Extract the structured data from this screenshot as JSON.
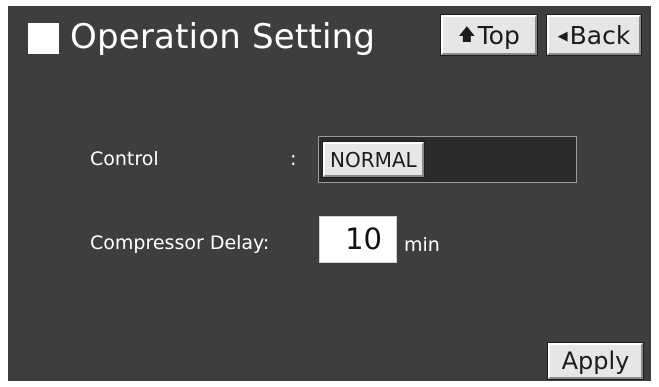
{
  "header": {
    "title": "Operation Setting",
    "top_button": {
      "icon": "up-arrow-icon",
      "label": "Top"
    },
    "back_button": {
      "icon": "left-triangle-icon",
      "label": "Back"
    }
  },
  "form": {
    "control": {
      "label": "Control",
      "separator": ":",
      "value": "NORMAL"
    },
    "compressor_delay": {
      "label": "Compressor Delay:",
      "value": "10",
      "unit": "min"
    }
  },
  "footer": {
    "apply_label": "Apply"
  },
  "colors": {
    "panel_background": "#3e3e3e",
    "button_face": "#e6e6e6",
    "text": "#ffffff",
    "field_background": "#2b2b2b"
  }
}
